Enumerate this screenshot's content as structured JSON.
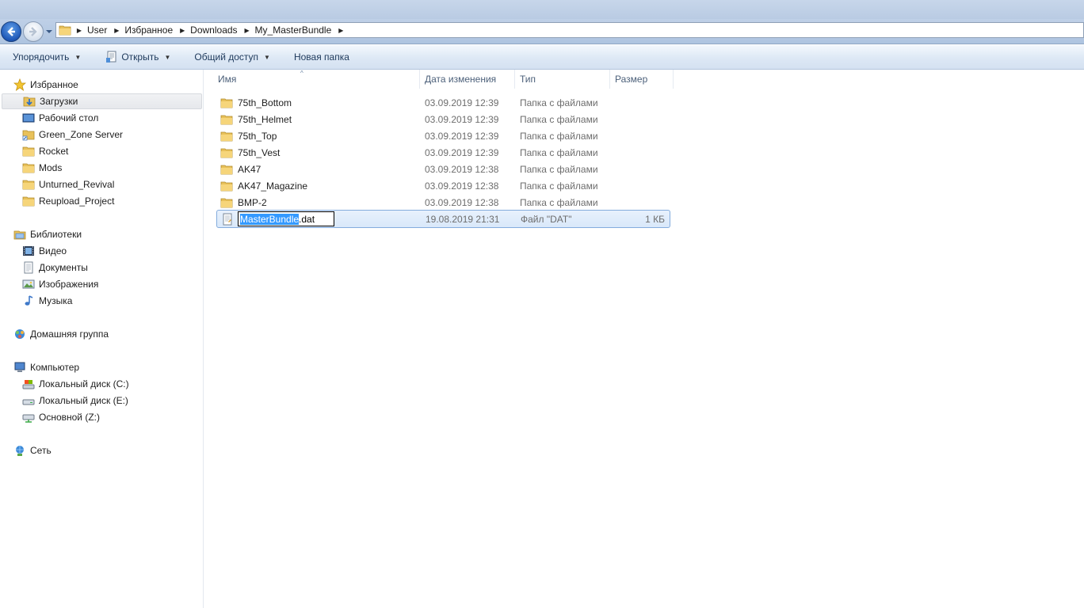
{
  "address": {
    "breadcrumbs": [
      "User",
      "Избранное",
      "Downloads",
      "My_MasterBundle"
    ]
  },
  "toolbar": {
    "organize": "Упорядочить",
    "open": "Открыть",
    "share": "Общий доступ",
    "new_folder": "Новая папка"
  },
  "sidebar": {
    "favorites": {
      "label": "Избранное",
      "items": [
        "Загрузки",
        "Рабочий стол",
        "Green_Zone Server",
        "Rocket",
        "Mods",
        "Unturned_Revival",
        "Reupload_Project"
      ]
    },
    "libraries": {
      "label": "Библиотеки",
      "items": [
        "Видео",
        "Документы",
        "Изображения",
        "Музыка"
      ]
    },
    "homegroup": {
      "label": "Домашняя группа"
    },
    "computer": {
      "label": "Компьютер",
      "items": [
        "Локальный диск (C:)",
        "Локальный диск (E:)",
        "Основной (Z:)"
      ]
    },
    "network": {
      "label": "Сеть"
    }
  },
  "columns": {
    "name": "Имя",
    "date": "Дата изменения",
    "type": "Тип",
    "size": "Размер"
  },
  "files": [
    {
      "name": "75th_Bottom",
      "date": "03.09.2019 12:39",
      "type": "Папка с файлами",
      "size": ""
    },
    {
      "name": "75th_Helmet",
      "date": "03.09.2019 12:39",
      "type": "Папка с файлами",
      "size": ""
    },
    {
      "name": "75th_Top",
      "date": "03.09.2019 12:39",
      "type": "Папка с файлами",
      "size": ""
    },
    {
      "name": "75th_Vest",
      "date": "03.09.2019 12:39",
      "type": "Папка с файлами",
      "size": ""
    },
    {
      "name": "AK47",
      "date": "03.09.2019 12:38",
      "type": "Папка с файлами",
      "size": ""
    },
    {
      "name": "AK47_Magazine",
      "date": "03.09.2019 12:38",
      "type": "Папка с файлами",
      "size": ""
    },
    {
      "name": "BMP-2",
      "date": "03.09.2019 12:38",
      "type": "Папка с файлами",
      "size": ""
    },
    {
      "name": "MasterBundle.dat",
      "date": "19.08.2019 21:31",
      "type": "Файл \"DAT\"",
      "size": "1 КБ"
    }
  ],
  "rename": {
    "selected_text": "MasterBundle",
    "rest_text": ".dat"
  }
}
